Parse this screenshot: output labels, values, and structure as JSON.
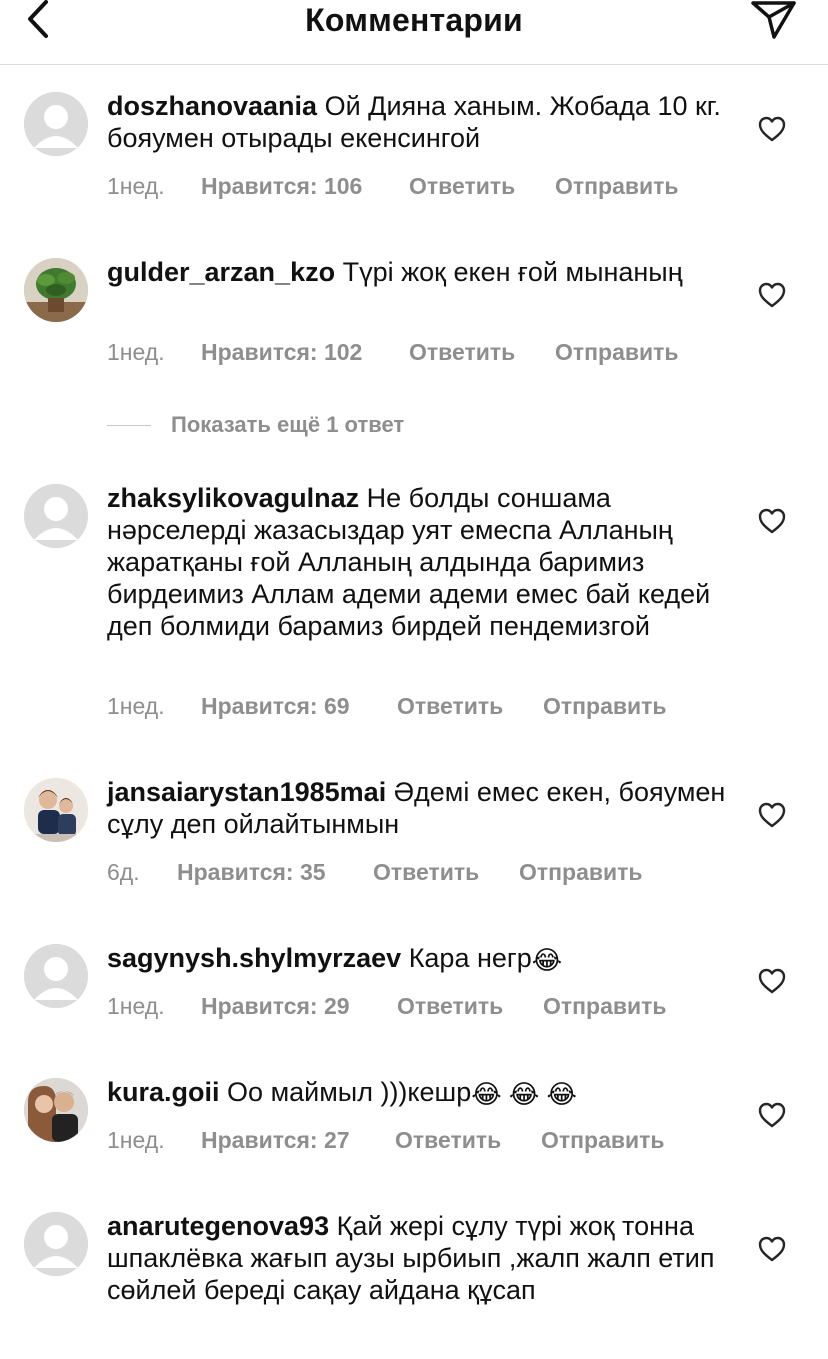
{
  "header": {
    "title": "Комментарии"
  },
  "more_replies": {
    "label": "Показать ещё 1 ответ"
  },
  "comments": [
    {
      "username": "doszhanovaania",
      "text": "Ой Дияна ханым. Жобада 10 кг. бояумен отырады екенсингой",
      "time": "1нед.",
      "likes": "Нравится: 106",
      "reply": "Ответить",
      "send": "Отправить",
      "avatar": "default-avatar"
    },
    {
      "username": "gulder_arzan_kzo",
      "text": "Түрі жоқ екен ғой мынаның",
      "time": "1нед.",
      "likes": "Нравится: 102",
      "reply": "Ответить",
      "send": "Отправить",
      "avatar": "plant-photo-avatar"
    },
    {
      "username": "zhaksylikovagulnaz",
      "text": "Не болды соншама нәрселерді жазасыздар уят емеспа Алланың жаратқаны ғой Алланың алдында баримиз бирдеимиз Аллам адеми адеми емес бай кедей деп болмиди барамиз бирдей пендемизгой",
      "time": "1нед.",
      "likes": "Нравится: 69",
      "reply": "Ответить",
      "send": "Отправить",
      "avatar": "default-avatar"
    },
    {
      "username": "jansaiarystan1985mai",
      "text": "Әдемі емес екен, бояумен сұлу деп ойлайтынмын",
      "time": "6д.",
      "likes": "Нравится: 35",
      "reply": "Ответить",
      "send": "Отправить",
      "avatar": "children-photo-avatar"
    },
    {
      "username": "sagynysh.shylmyrzaev",
      "text": "Кара негр",
      "emoji": "😂",
      "time": "1нед.",
      "likes": "Нравится: 29",
      "reply": "Ответить",
      "send": "Отправить",
      "avatar": "default-avatar"
    },
    {
      "username": "kura.goii",
      "text": "Оо маймыл )))кешр",
      "emoji": "😂 😂 😂",
      "time": "1нед.",
      "likes": "Нравится: 27",
      "reply": "Ответить",
      "send": "Отправить",
      "avatar": "couple-photo-avatar"
    },
    {
      "username": "anarutegenova93",
      "text": "Қай жері сұлу түрі жоқ тонна шпаклёвка жағып аузы ырбиып ,жалп жалп етип сөйлей береді сақау айдана құсап",
      "avatar": "default-avatar"
    }
  ],
  "icons": {
    "back": "chevron-left-icon",
    "send": "paper-plane-icon",
    "like": "heart-outline-icon"
  }
}
